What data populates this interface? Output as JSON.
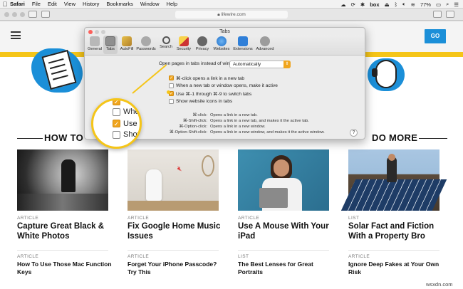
{
  "menubar": {
    "apple": "",
    "items": [
      "Safari",
      "File",
      "Edit",
      "View",
      "History",
      "Bookmarks",
      "Window",
      "Help"
    ],
    "status": {
      "box": "box",
      "battery": "77%"
    }
  },
  "browser": {
    "url": "lifewire.com"
  },
  "site": {
    "go_button": "GO",
    "section_left": "HOW TO",
    "section_right": "DO MORE"
  },
  "cards": [
    {
      "kicker1": "ARTICLE",
      "title1": "Capture Great Black & White Photos",
      "kicker2": "ARTICLE",
      "title2": "How To Use Those Mac Function Keys"
    },
    {
      "kicker1": "ARTICLE",
      "title1": "Fix Google Home Music Issues",
      "kicker2": "ARTICLE",
      "title2": "Forget Your iPhone Passcode? Try This"
    },
    {
      "kicker1": "ARTICLE",
      "title1": "Use A Mouse With Your iPad",
      "kicker2": "LIST",
      "title2": "The Best Lenses for Great Portraits"
    },
    {
      "kicker1": "LIST",
      "title1": "Solar Fact and Fiction With a Property Bro",
      "kicker2": "ARTICLE",
      "title2": "Ignore Deep Fakes at Your Own Risk"
    }
  ],
  "prefs": {
    "title": "Tabs",
    "tabs": [
      "General",
      "Tabs",
      "AutoFill",
      "Passwords",
      "Search",
      "Security",
      "Privacy",
      "Websites",
      "Extensions",
      "Advanced"
    ],
    "open_pages_label": "Open pages in tabs instead of windows:",
    "open_pages_value": "Automatically",
    "options": [
      {
        "label": "⌘-click opens a link in a new tab",
        "checked": true
      },
      {
        "label": "When a new tab or window opens, make it active",
        "checked": false
      },
      {
        "label": "Use ⌘-1 through ⌘-9 to switch tabs",
        "checked": true
      },
      {
        "label": "Show website icons in tabs",
        "checked": false
      }
    ],
    "shortcuts": [
      {
        "keys": "⌘-click:",
        "desc": "Opens a link in a new tab."
      },
      {
        "keys": "⌘-Shift-click:",
        "desc": "Opens a link in a new tab, and makes it the active tab."
      },
      {
        "keys": "⌘-Option-click:",
        "desc": "Opens a link in a new window."
      },
      {
        "keys": "⌘-Option-Shift-click:",
        "desc": "Opens a link in a new window, and makes it the active window."
      }
    ],
    "help": "?"
  },
  "magnifier": {
    "rows": [
      {
        "text": "Whe",
        "checked": false
      },
      {
        "text": "Use ⌘",
        "checked": true
      },
      {
        "text": "Show",
        "checked": false
      }
    ]
  },
  "watermark": "wsxdn.com",
  "colors": {
    "accent": "#f5c518",
    "brand_blue": "#1b8fd8",
    "checkbox_on": "#f0a51e"
  }
}
